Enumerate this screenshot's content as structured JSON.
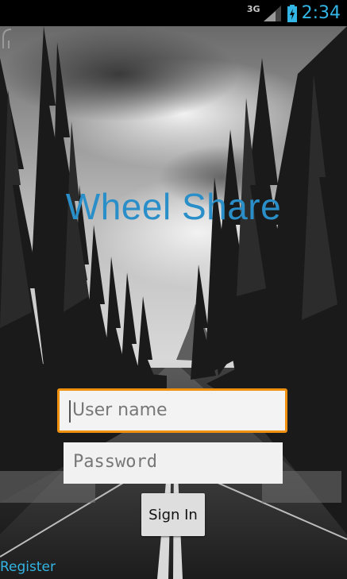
{
  "status_bar": {
    "network_type": "3G",
    "time": "2:34",
    "icons": [
      "signal-icon",
      "battery-charging-icon"
    ],
    "clock_color": "#33b5e5"
  },
  "app": {
    "title": "Wheel Share",
    "title_color": "#2a8fc8"
  },
  "form": {
    "username_placeholder": "User name",
    "password_placeholder": "Password",
    "sign_in_label": "Sign In",
    "focus_color": "#f0900f"
  },
  "footer": {
    "register_label": "Register",
    "link_color": "#33b5e5"
  }
}
